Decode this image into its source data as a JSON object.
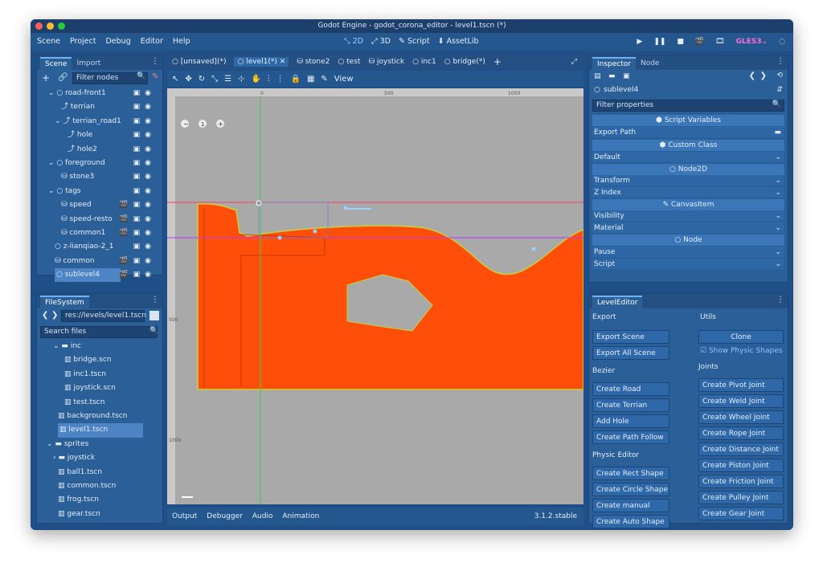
{
  "window": {
    "title": "Godot Engine - godot_corona_editor - level1.tscn (*)"
  },
  "menu": {
    "items": [
      "Scene",
      "Project",
      "Debug",
      "Editor",
      "Help"
    ],
    "workspaces": [
      "2D",
      "3D",
      "Script",
      "AssetLib"
    ],
    "renderer": "GLES3"
  },
  "scene_dock": {
    "tabs": [
      "Scene",
      "Import"
    ],
    "filter_placeholder": "Filter nodes",
    "nodes": [
      {
        "label": "road-front1"
      },
      {
        "label": "terrian"
      },
      {
        "label": "terrian_road1"
      },
      {
        "label": "hole"
      },
      {
        "label": "hole2"
      },
      {
        "label": "foreground"
      },
      {
        "label": "stone3"
      },
      {
        "label": "tags"
      },
      {
        "label": "speed"
      },
      {
        "label": "speed-resto"
      },
      {
        "label": "common1"
      },
      {
        "label": "z-lianqiao-2_1"
      },
      {
        "label": "common"
      },
      {
        "label": "sublevel4"
      }
    ]
  },
  "filesystem": {
    "tab": "FileSystem",
    "path": "res://levels/level1.tscn",
    "search_placeholder": "Search files",
    "items": [
      {
        "label": "inc"
      },
      {
        "label": "bridge.scn"
      },
      {
        "label": "inc1.tscn"
      },
      {
        "label": "joystick.scn"
      },
      {
        "label": "test.tscn"
      },
      {
        "label": "background.tscn"
      },
      {
        "label": "level1.tscn"
      },
      {
        "label": "sprites"
      },
      {
        "label": "joystick"
      },
      {
        "label": "ball1.tscn"
      },
      {
        "label": "common.tscn"
      },
      {
        "label": "frog.tscn"
      },
      {
        "label": "gear.tscn"
      }
    ]
  },
  "editor": {
    "tabs": [
      "[unsaved](*)",
      "level1(*)",
      "stone2",
      "test",
      "joystick",
      "inc1",
      "bridge(*)"
    ],
    "view_label": "View",
    "ruler_labels": [
      "0",
      "500",
      "1000",
      "500",
      "1000"
    ],
    "zoom_label": "1"
  },
  "bottom": {
    "tabs": [
      "Output",
      "Debugger",
      "Audio",
      "Animation"
    ],
    "version": "3.1.2.stable"
  },
  "inspector": {
    "tabs": [
      "Inspector",
      "Node"
    ],
    "node_name": "sublevel4",
    "filter_placeholder": "Filter properties",
    "rows": {
      "script_variables": "Script Variables",
      "export_path": "Export Path",
      "custom_class": "Custom Class",
      "default": "Default",
      "node2d": "Node2D",
      "transform": "Transform",
      "z_index": "Z Index",
      "canvas_item": "CanvasItem",
      "visibility": "Visibility",
      "material": "Material",
      "node": "Node",
      "pause": "Pause",
      "script": "Script"
    }
  },
  "level_editor": {
    "tab": "LevelEditor",
    "export_label": "Export",
    "export_scene": "Export Scene",
    "export_all_scene": "Export All Scene",
    "bezier_label": "Bezier",
    "create_road": "Create Road",
    "create_terrian": "Create Terrian",
    "add_hole": "Add Hole",
    "create_path_follow": "Create Path Follow",
    "physic_editor_label": "Physic Editor",
    "create_rect_shape": "Create Rect Shape",
    "create_circle_shape": "Create Circle Shape",
    "create_manual_shape": "Create manual Shape",
    "create_auto_shape": "Create Auto Shape",
    "utils_label": "Utils",
    "clone": "Clone",
    "show_physic_shapes": "Show Physic Shapes",
    "joints_label": "Joints",
    "joints": [
      "Create Pivot Joint",
      "Create Weld Joint",
      "Create Wheel Joint",
      "Create Rope Joint",
      "Create Distance Joint",
      "Create Piston Joint",
      "Create Friction Joint",
      "Create Pulley Joint",
      "Create Gear Joint"
    ]
  },
  "colors": {
    "terrain_fill": "#ff4d0a",
    "terrain_edge": "#c8d13a",
    "viewport_bg": "#a9a9a9",
    "axis_vertical": "#39d24a",
    "axis_horizontal": "#ff3b6b",
    "accent": "#6fb2f5"
  }
}
